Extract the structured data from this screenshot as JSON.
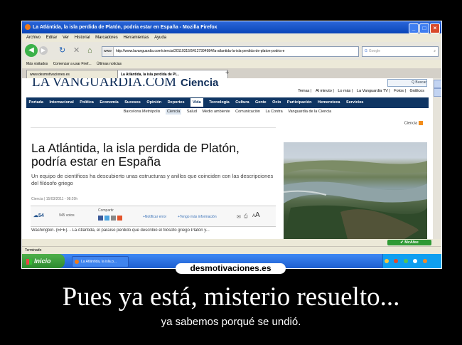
{
  "window": {
    "title": "La Atlántida, la isla perdida de Platón, podría estar en España - Mozilla Firefox"
  },
  "menu": [
    "Archivo",
    "Editar",
    "Ver",
    "Historial",
    "Marcadores",
    "Herramientas",
    "Ayuda"
  ],
  "nav": {
    "url_prefix": "www",
    "url": "http://www.lavanguardia.com/ciencia/20110315/54127394984/la-atlantida-la-isla-perdida-de-platon-podria-e",
    "search_placeholder": "Google"
  },
  "bookmarks": [
    "Más visitados",
    "Comenzar a usar Firef...",
    "Últimas noticias"
  ],
  "tabs": [
    "www.desmotivaciones.es",
    "La Atlántida, la isla perdida de Pl..."
  ],
  "page": {
    "logo": "LA VANGUARDIA.COM",
    "section": "Ciencia",
    "search_label": "Q Buscar",
    "util_nav": [
      "Temas",
      "Al minuto",
      "Lo más",
      "La Vanguardia TV",
      "Fotos",
      "Gráficos"
    ],
    "main_nav": [
      "Portada",
      "Internacional",
      "Política",
      "Economía",
      "Sucesos",
      "Opinión",
      "Deportes",
      "Vida",
      "Tecnología",
      "Cultura",
      "Gente",
      "Ocio",
      "Participación",
      "Hemeroteca",
      "Servicios"
    ],
    "main_nav_selected": "Vida",
    "sub_nav": [
      "Barcelona Metrópolis",
      "Ciencia",
      "Salud",
      "Medio ambiente",
      "Comunicación",
      "La Contra",
      "Vanguardia de la Ciencia"
    ],
    "sub_nav_selected": "Ciencia",
    "rss": "Ciencia",
    "headline": "La Atlántida, la isla perdida de Platón, podría estar en España",
    "subtitle": "Un equipo de científicos ha descubierto unas estructuras y anillos que coinciden con las descripciones del filósofo griego",
    "byline": "Ciencia | 15/03/2011 - 08:20h",
    "share": {
      "count": "54",
      "votes": "945 votos",
      "compartir": "Compartir",
      "add_error": "+Notificar error",
      "info": "+Tengo más información"
    },
    "body_start": "Washington. (EFE). - La Atlántida, el paraíso perdido que describió el filósofo griego Platón y..."
  },
  "notification": {
    "mcafee": "McAfee"
  },
  "status": "Terminado",
  "taskbar": {
    "start": "Inicio",
    "item": "La Atlántida, la isla p..."
  },
  "watermark": "desmotivaciones.es",
  "caption": {
    "title": "Pues ya está, misterio resuelto...",
    "subtitle": "ya sabemos porqué se undió."
  }
}
